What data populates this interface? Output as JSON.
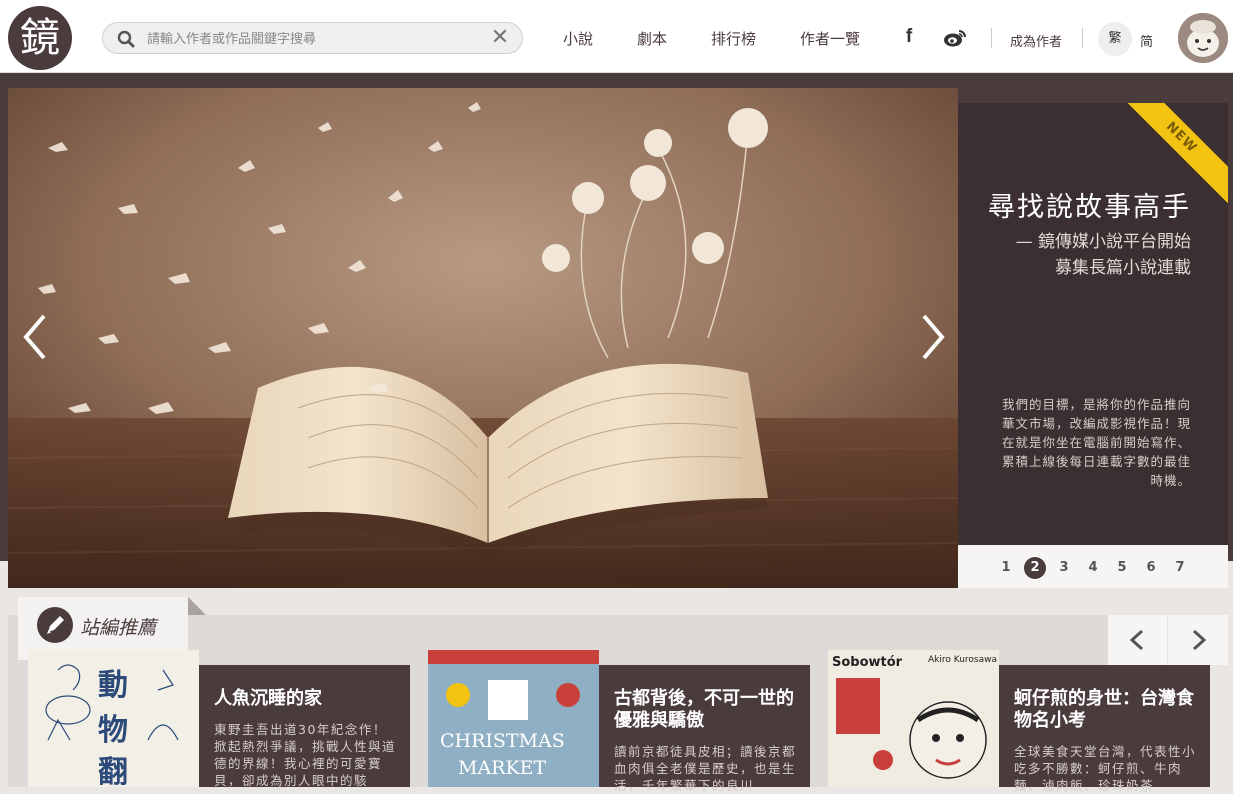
{
  "header": {
    "logo_text": "鏡",
    "search_placeholder": "請輸入作者或作品關鍵字搜尋",
    "nav": [
      "小說",
      "劇本",
      "排行榜",
      "作者一覽"
    ],
    "become_author": "成為作者",
    "lang_traditional": "繁",
    "lang_simplified": "简"
  },
  "hero": {
    "badge": "NEW",
    "title": "尋找說故事高手",
    "subtitle_1": "— 鏡傳媒小說平台開始",
    "subtitle_2": "募集長篇小說連載",
    "description": "我們的目標，是將你的作品推向華文市場，改編成影視作品！現在就是你坐在電腦前開始寫作、累積上線後每日連載字數的最佳時機。",
    "pages": [
      "1",
      "2",
      "3",
      "4",
      "5",
      "6",
      "7"
    ],
    "active_page": 2
  },
  "recommend": {
    "label": "站編推薦",
    "cards": [
      {
        "title": "人魚沉睡的家",
        "desc": "東野圭吾出道30年紀念作！掀起熱烈爭議，挑戰人性與道德的界線！我心裡的可愛寶貝，卻成為別人眼中的駭"
      },
      {
        "title": "古都背後，不可一世的優雅與驕傲",
        "desc": "讀前京都徒具皮相；讀後京都血肉俱全老僕是歷史，也是生活，千年繁華下的良川"
      },
      {
        "title": "蚵仔煎的身世：台灣食物名小考",
        "desc": "全球美食天堂台灣，代表性小吃多不勝數：蚵仔煎、牛肉麵、滷肉飯、珍珠奶茶"
      }
    ]
  },
  "colors": {
    "brand": "#4a3b3d",
    "accent": "#f2c311"
  }
}
